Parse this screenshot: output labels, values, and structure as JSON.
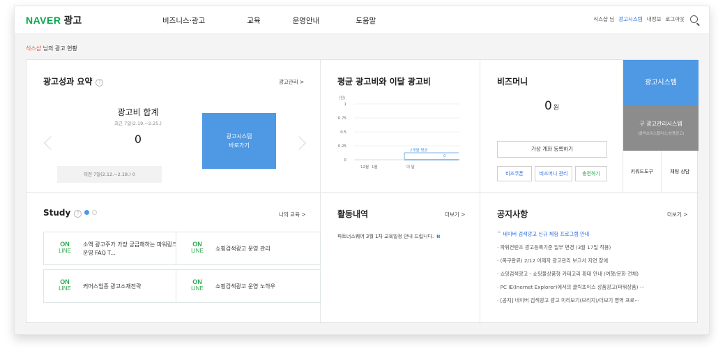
{
  "header": {
    "logo_brand": "NAVER",
    "logo_text": "광고",
    "nav": [
      "비즈니스·광고",
      "교육",
      "운영안내",
      "도움말"
    ],
    "user": "식스샵 님",
    "links": [
      "광고시스템",
      "내정보",
      "로그아웃"
    ]
  },
  "breadcrumb": {
    "name": "식스샵",
    "suffix": " 님의 광고 현황"
  },
  "summary": {
    "title": "광고성과 요약",
    "help": "?",
    "manage_link": "광고관리 >",
    "total_label": "광고비 합계",
    "period": "최근 7일(2.19.~2.25.)",
    "value": "0",
    "prev": "이전 7일(2.12.~2.18.)  0",
    "go_button_line1": "광고시스템",
    "go_button_line2": "바로가기"
  },
  "cost": {
    "title": "평균 광고비와 이달 광고비"
  },
  "chart_data": {
    "type": "line",
    "title": "평균 광고비와 이달 광고비",
    "ylabel": "(원)",
    "yticks": [
      "0",
      "0.25",
      "0.5",
      "0.75",
      "1"
    ],
    "ylim": [
      0,
      1
    ],
    "categories": [
      "12월",
      "1월",
      "이 달"
    ],
    "values": [
      0,
      0,
      0
    ],
    "annotation": "2개월 평균",
    "annotation_value": "0",
    "grid": true
  },
  "bizmoney": {
    "title": "비즈머니",
    "amount": "0",
    "unit": "원",
    "register": "가상 계좌 등록하기",
    "coupon": "비즈쿠폰",
    "manage": "비즈머니 관리",
    "charge": "충전하기"
  },
  "systems": {
    "primary": "광고시스템",
    "legacy": "구 광고관리시스템",
    "legacy_sub": "(클릭초이스플러스/상품광고)",
    "keyword_tool": "키워드도구",
    "chat": "채팅 상담"
  },
  "study": {
    "title": "Study",
    "help": "?",
    "link": "나의 교육 >",
    "badge_on": "ON",
    "badge_line": "LINE",
    "cards": [
      "소액 광고주가 가장 궁금해하는 파워링크 운영 FAQ T...",
      "쇼핑검색광고 운영 관리",
      "커머스업종 광고소재전략",
      "쇼핑검색광고 운영 노하우"
    ]
  },
  "activity": {
    "title": "활동내역",
    "more": "더보기 >",
    "item": "파트너스퀘어 3월 1차 교육일정 안내 드립니다.",
    "badge": "N"
  },
  "notice": {
    "title": "공지사항",
    "more": "더보기 >",
    "quote": "❝",
    "items": [
      "네이버 검색광고 신규 체험 프로그램 안내",
      "· 파워컨텐츠 광고등록기준 일부 변경 (3월 17일 적용)",
      "· (복구완료) 2/12 어제자 광고관리 보고서 지연 장애",
      "· 쇼핑검색광고 - 쇼핑몰상품형 카테고리 확대 안내 (여행/문화 전체)",
      "· PC IE(Inernet Explorer)에서의 클릭초이스 상품광고(파워상품) ···",
      "· [공지] 네이버 검색광고 광고 미리보기(브리지)/더보기 영역 프로···"
    ]
  },
  "colors": {
    "naver_green": "#03a74c",
    "accent_blue": "#4f98e3",
    "legacy_gray": "#8c8c8c",
    "online_green": "#2aa84a"
  }
}
